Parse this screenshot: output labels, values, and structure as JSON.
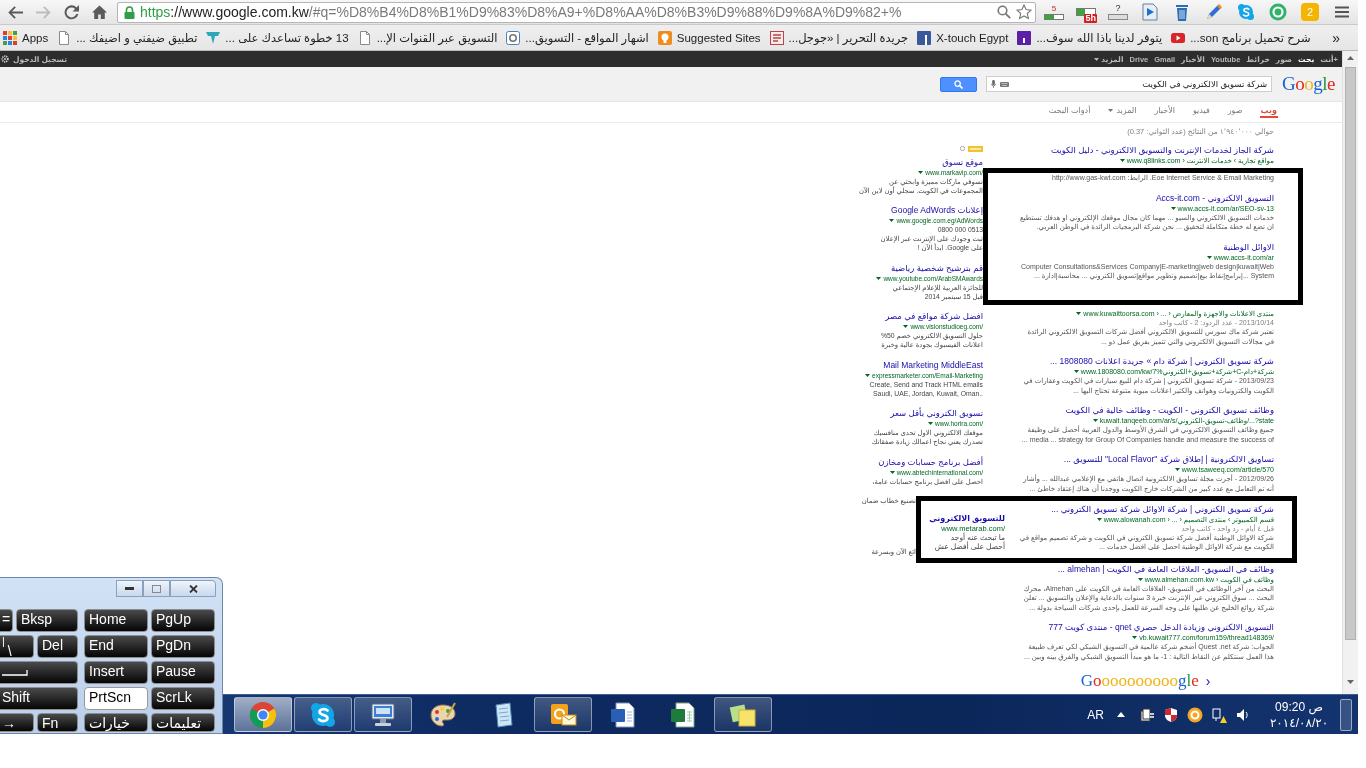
{
  "browser": {
    "nav": [
      {
        "kind": "back",
        "disabled": false
      },
      {
        "kind": "forward",
        "disabled": true
      },
      {
        "kind": "reload",
        "disabled": false
      },
      {
        "kind": "home",
        "disabled": false
      }
    ],
    "address": {
      "scheme": "https",
      "host": "://www.google.com.kw",
      "path": "/#q=%D8%B4%D8%B1%D9%83%D8%A9+%D8%AA%D8%B3%D9%88%D9%8A%D9%82+%"
    },
    "extensions": [
      {
        "kind": "meter",
        "label": "5"
      },
      {
        "kind": "window",
        "label": "5h"
      },
      {
        "kind": "bar",
        "label": "?"
      },
      {
        "kind": "play"
      },
      {
        "kind": "trash"
      },
      {
        "kind": "pen"
      },
      {
        "kind": "skype"
      },
      {
        "kind": "ring"
      },
      {
        "kind": "tile",
        "label": "2"
      }
    ]
  },
  "bookmarks": {
    "items": [
      {
        "kind": "video",
        "label": "شرح تحميل برنامج son..."
      },
      {
        "kind": "purple",
        "label": "يتوفر لدينا باذا الله سوف..."
      },
      {
        "kind": "blue",
        "label": "X-touch Egypt"
      },
      {
        "kind": "news",
        "label": "جريدة التحرير | «جوجل..."
      },
      {
        "kind": "bulb",
        "label": "Suggested Sites"
      },
      {
        "kind": "ring",
        "label": "اشهار المواقع - التسويق..."
      },
      {
        "kind": "page",
        "label": "التسويق عبر القنوات الإ..."
      },
      {
        "kind": "funnel",
        "label": "13 خطوة تساعدك على ..."
      },
      {
        "kind": "page",
        "label": "تطبيق ضيفني و اضيفك ..."
      },
      {
        "kind": "apps",
        "label": "Apps"
      }
    ],
    "more": "»"
  },
  "google_bar": {
    "sign_in": "تسجيل الدخول",
    "links": [
      {
        "label": "+أنت",
        "selected": false,
        "dropdown": false
      },
      {
        "label": "بحث",
        "selected": true,
        "dropdown": false
      },
      {
        "label": "صور",
        "selected": false,
        "dropdown": false
      },
      {
        "label": "خرائط",
        "selected": false,
        "dropdown": false
      },
      {
        "label": "Youtube",
        "selected": false,
        "dropdown": false
      },
      {
        "label": "الأخبار",
        "selected": false,
        "dropdown": false
      },
      {
        "label": "Gmail",
        "selected": false,
        "dropdown": false
      },
      {
        "label": "Drive",
        "selected": false,
        "dropdown": false
      },
      {
        "label": "المزيد",
        "selected": false,
        "dropdown": true
      }
    ]
  },
  "search": {
    "logo": "Google",
    "query": "شركة تسويق الالكتروني في الكويت"
  },
  "tabs": [
    {
      "label": "ويب",
      "selected": true,
      "dropdown": false
    },
    {
      "label": "صور",
      "selected": false,
      "dropdown": false
    },
    {
      "label": "فيديو",
      "selected": false,
      "dropdown": false
    },
    {
      "label": "الأخبار",
      "selected": false,
      "dropdown": false
    },
    {
      "label": "المزيد",
      "selected": false,
      "dropdown": true
    },
    {
      "label": "أدوات البحث",
      "selected": false,
      "dropdown": false
    }
  ],
  "results_stats": "حوالي ١٬٩٤٠٬٠٠٠ من النتائج (عدد الثواني: 0.37)",
  "results": [
    {
      "kind": "result",
      "title": "شركة الجاز لخدمات الإنترنت والتسويق الالكتروني - دليل الكويت",
      "url": "www.q8links.com › مواقع تجارية › خدمات الانترنت"
    },
    {
      "kind": "box",
      "results": [
        {
          "snippet": "Eoe Internet Service & Email Marketing. الرابط: http://www.gas-kwt.com"
        },
        {
          "title": "التسويق الالكتروني - Accs-it.com",
          "url": "www.accs-it.com/ar/SEO-sv-13",
          "snippet": "خدمات التسويق الالكتروني والسيو ... مهما كان مجال موقعك الإلكتروني او هدفك تستطيع ان تضع له خطة متكاملة لتحقيق ... نحن شركة البرمجيات الرائدة في الوطن العربي."
        },
        {
          "title": "الاوائل الوطنية",
          "url": "www.accs-it.com/ar",
          "snippet": "Computer Consultations&Services Company|E-marketing|web design|kuwait|Web ... System|برامج|نقاط بيع|تصميم وتطوير مواقع|تسويق الكتروني ... محاسبة|ادارة ..."
        }
      ]
    },
    {
      "kind": "result",
      "url": "www.kuwaittoorsa.com › ... › منتدى الاعلانات والاجهزة والمعارض",
      "meta": "2013/10/14 - عدد الردود: 2 - كاتب واحد",
      "snippet": "تعتبر شركة ماك سورس للتسويق الالكتروني أفضل شركات التسويق الالكتروني الرائدة في مجالات التسويق الالكتروني والتي تتميز بفريق عمل ذو ..."
    },
    {
      "kind": "result",
      "title": "شركة تسويق الكتروني | شركة دام » جريدة اعلانات 1808080 ...",
      "url": "www.1808080.com/kw/7%شركة+تسويق+الكتروني+C-شركة+دام",
      "snippet": "2013/09/23 - شركة تسويق الكتروني | شركة دام للبيع سيارات في الكويت وعقارات في الكويت والكترونيات وهواتف والكثير اعلانات مبوبة متنوعة تحتاج اليها ..."
    },
    {
      "kind": "result",
      "title": "وظائف تسويق الكتروني - الكويت - وظائف خالية في الكويت",
      "url": "kuwait.tanqeeb.com/ar/s/وظائف-تسويق-الكتروني/...?state",
      "snippet": "جميع وظائف التسويق الالكتروني في الشرق الأوسط والدول العربية أحصل على وظيفة media ... strategy for Group Of Companies handle and measure the success of ..."
    },
    {
      "kind": "result",
      "title": "تساويق الالكترونية | إطلاق شركة \"Local Flavor\" للتسويق ...",
      "url": "www.tsaweeq.com/article/570",
      "snippet": "2012/09/26 - أجرت مجلة تساويق الالكترونية اتصال هاتفي مع الإعلامي عبدالله ... وأشار أنه تم التعامل مع عدد كبير من الشركات خارج الكويت ووجدنا أن هناك إعتقاد خاطئ ..."
    },
    {
      "kind": "box",
      "results": [
        {
          "title": "شركة تسويق الكتروني | شركة الاوائل شركة تسويق الكتروني ...",
          "url": "www.alowanah.com › ... › قسم الكمبيوتر › منتدى التصميم",
          "meta": "قبل ٤ أيام - رد واحد - كاتب واحد",
          "snippet": "شركة الاوائل الوطنية أفضل شركة تسويق الكتروني في الكويت و شركة تصميم مواقع في الكويت مع شركة الاوائل الوطنية احصل على افضل خدمات ..."
        }
      ],
      "ads": [
        {
          "title": "للتسويق الالكتروني",
          "url": "www.metarab.com/",
          "lines": [
            "ما تبحث عنه أوجد",
            "أحصل على أفضل عش"
          ]
        }
      ]
    },
    {
      "kind": "result",
      "title": "وظائف في التسويق- العلاقات العامة في الكويت | almehan ...",
      "url": "www.almehan.com.kw › وظائف في الكويت",
      "snippet": "البحث من آخر الوظائف في التسويق- العلاقات العامة في الكويت على Almehan، محرك البحث ... سوق الكتروني عبر الإنترنت خبرة 3 سنوات بالدعاية والإعلان والتسويق ... تعلن شركة روائع الخليج عن طلبها على وجه السرعة للعمل بإحدى شركات السياحة بدولة ..."
    },
    {
      "kind": "result",
      "title": "التسويق الالكتروني وزيادة الدخل حصري qnet - منتدى كويت 777",
      "url": "vb.kuwait777.com/forum159/thread148369/",
      "snippet": "الجواب: شركة Quest .net أضخم شركة عالمية في التسويق الشبكي لكي تعرف طبيعة هذا العمل سنتكلم عن النقاط التالية : 1- ما هو مبدأ التسويق الشبكي والفرق بينه وبين ..."
    }
  ],
  "ads": {
    "items": [
      {
        "title": "موقع تسوق",
        "url": "www.markavip.com/",
        "lines": [
          "تسوقي ماركات مميزة وابحثي عن",
          "المجموعات في الكويت. سجلي أون لاين الآن"
        ]
      },
      {
        "title": "إعلانات Google AdWords",
        "url": "www.google.com.eg/AdWords",
        "lines": [
          "0800 000 0513",
          "ثبت وجودك على الإنترنت عبر الإعلان",
          "على Google. ابدأ الآن !"
        ]
      },
      {
        "title": "قم بترشيح شخصية رياضية",
        "url": "www.youtube.com/ArabSMAwards",
        "lines": [
          "للجائزة العربية للإعلام الإجتماعي",
          "قبل 15 سبتمبر 2014"
        ]
      },
      {
        "title": "افضل شركة مواقع في مصر",
        "url": "www.visionstudioeg.com/",
        "lines": [
          "حلول التسويق الالكتروني خصم 50%",
          "اعلانات الفيسبوك بجودة عالية وخبرة"
        ]
      },
      {
        "title": "Mail Marketing MiddleEast",
        "url": "expressmarketer.com/Email-Marketing",
        "lines": [
          "Create, Send and Track HTML emails",
          "Saudi, UAE, Jordan, Kuwait, Oman.."
        ]
      },
      {
        "title": "تسويق الكتروني بأقل سعر",
        "url": "www.horira.com/",
        "lines": [
          "موقعك الالكتروني الاول تحدى منافسيك",
          "تصدرك يعني نجاح اعمالك زيادة صفقاتك"
        ]
      },
      {
        "title": "أفضل برنامج حسابات ومخازن",
        "url": "www.abtechinternational.com/",
        "lines": [
          "احصل على افضل برنامج حسابات عامة،"
        ]
      }
    ],
    "cut_lines": [
      "تصنيع خطاب ضمان",
      "ائع الآن وبسرعة"
    ]
  },
  "pager": {
    "logo": "Goooooooooogle",
    "next": "›"
  },
  "keyboard": {
    "rows": [
      [
        {
          "kind": "nav",
          "label": "PgUp",
          "pressed": false
        },
        {
          "kind": "nav",
          "label": "Home",
          "pressed": false
        },
        {
          "kind": "wide",
          "label": "Bksp",
          "pressed": false
        },
        {
          "kind": "partial",
          "label": "=",
          "pressed": false
        }
      ],
      [
        {
          "kind": "nav",
          "label": "PgDn",
          "pressed": false
        },
        {
          "kind": "nav",
          "label": "End",
          "pressed": false
        },
        {
          "kind": "normal",
          "label": "Del",
          "pressed": false
        },
        {
          "kind": "partial",
          "label": "\\",
          "shift": "|",
          "pressed": false
        }
      ],
      [
        {
          "kind": "nav",
          "label": "Pause",
          "pressed": false
        },
        {
          "kind": "nav",
          "label": "Insert",
          "pressed": false
        },
        {
          "kind": "enter",
          "pressed": false
        }
      ],
      [
        {
          "kind": "nav",
          "label": "ScrLk",
          "pressed": false
        },
        {
          "kind": "nav",
          "label": "PrtScn",
          "pressed": true
        },
        {
          "kind": "partial",
          "label": "Shift",
          "pressed": false
        }
      ],
      [
        {
          "kind": "nav",
          "label": "تعليمات",
          "pressed": false
        },
        {
          "kind": "nav",
          "label": "خيارات",
          "pressed": false
        },
        {
          "kind": "normal",
          "label": "Fn",
          "pressed": false
        },
        {
          "kind": "partial",
          "label": "→",
          "pressed": false
        }
      ]
    ]
  },
  "taskbar": {
    "apps": [
      {
        "kind": "chrome",
        "running": true,
        "active": true
      },
      {
        "kind": "skype",
        "running": true,
        "active": false
      },
      {
        "kind": "keyboard",
        "running": true,
        "active": false
      },
      {
        "kind": "paint",
        "running": false,
        "active": false
      },
      {
        "kind": "notepad",
        "running": false,
        "active": false
      },
      {
        "kind": "outlook",
        "running": true,
        "active": false
      },
      {
        "kind": "word",
        "running": false,
        "active": false
      },
      {
        "kind": "excel",
        "running": false,
        "active": false
      },
      {
        "kind": "sticky",
        "running": true,
        "active": false
      }
    ],
    "language": "AR",
    "tray": [
      {
        "kind": "power"
      },
      {
        "kind": "shield"
      },
      {
        "kind": "ring"
      },
      {
        "kind": "network"
      },
      {
        "kind": "speaker"
      }
    ],
    "time": "09:20 ص",
    "date": "٢٠١٤/٠٨/٢٠"
  }
}
